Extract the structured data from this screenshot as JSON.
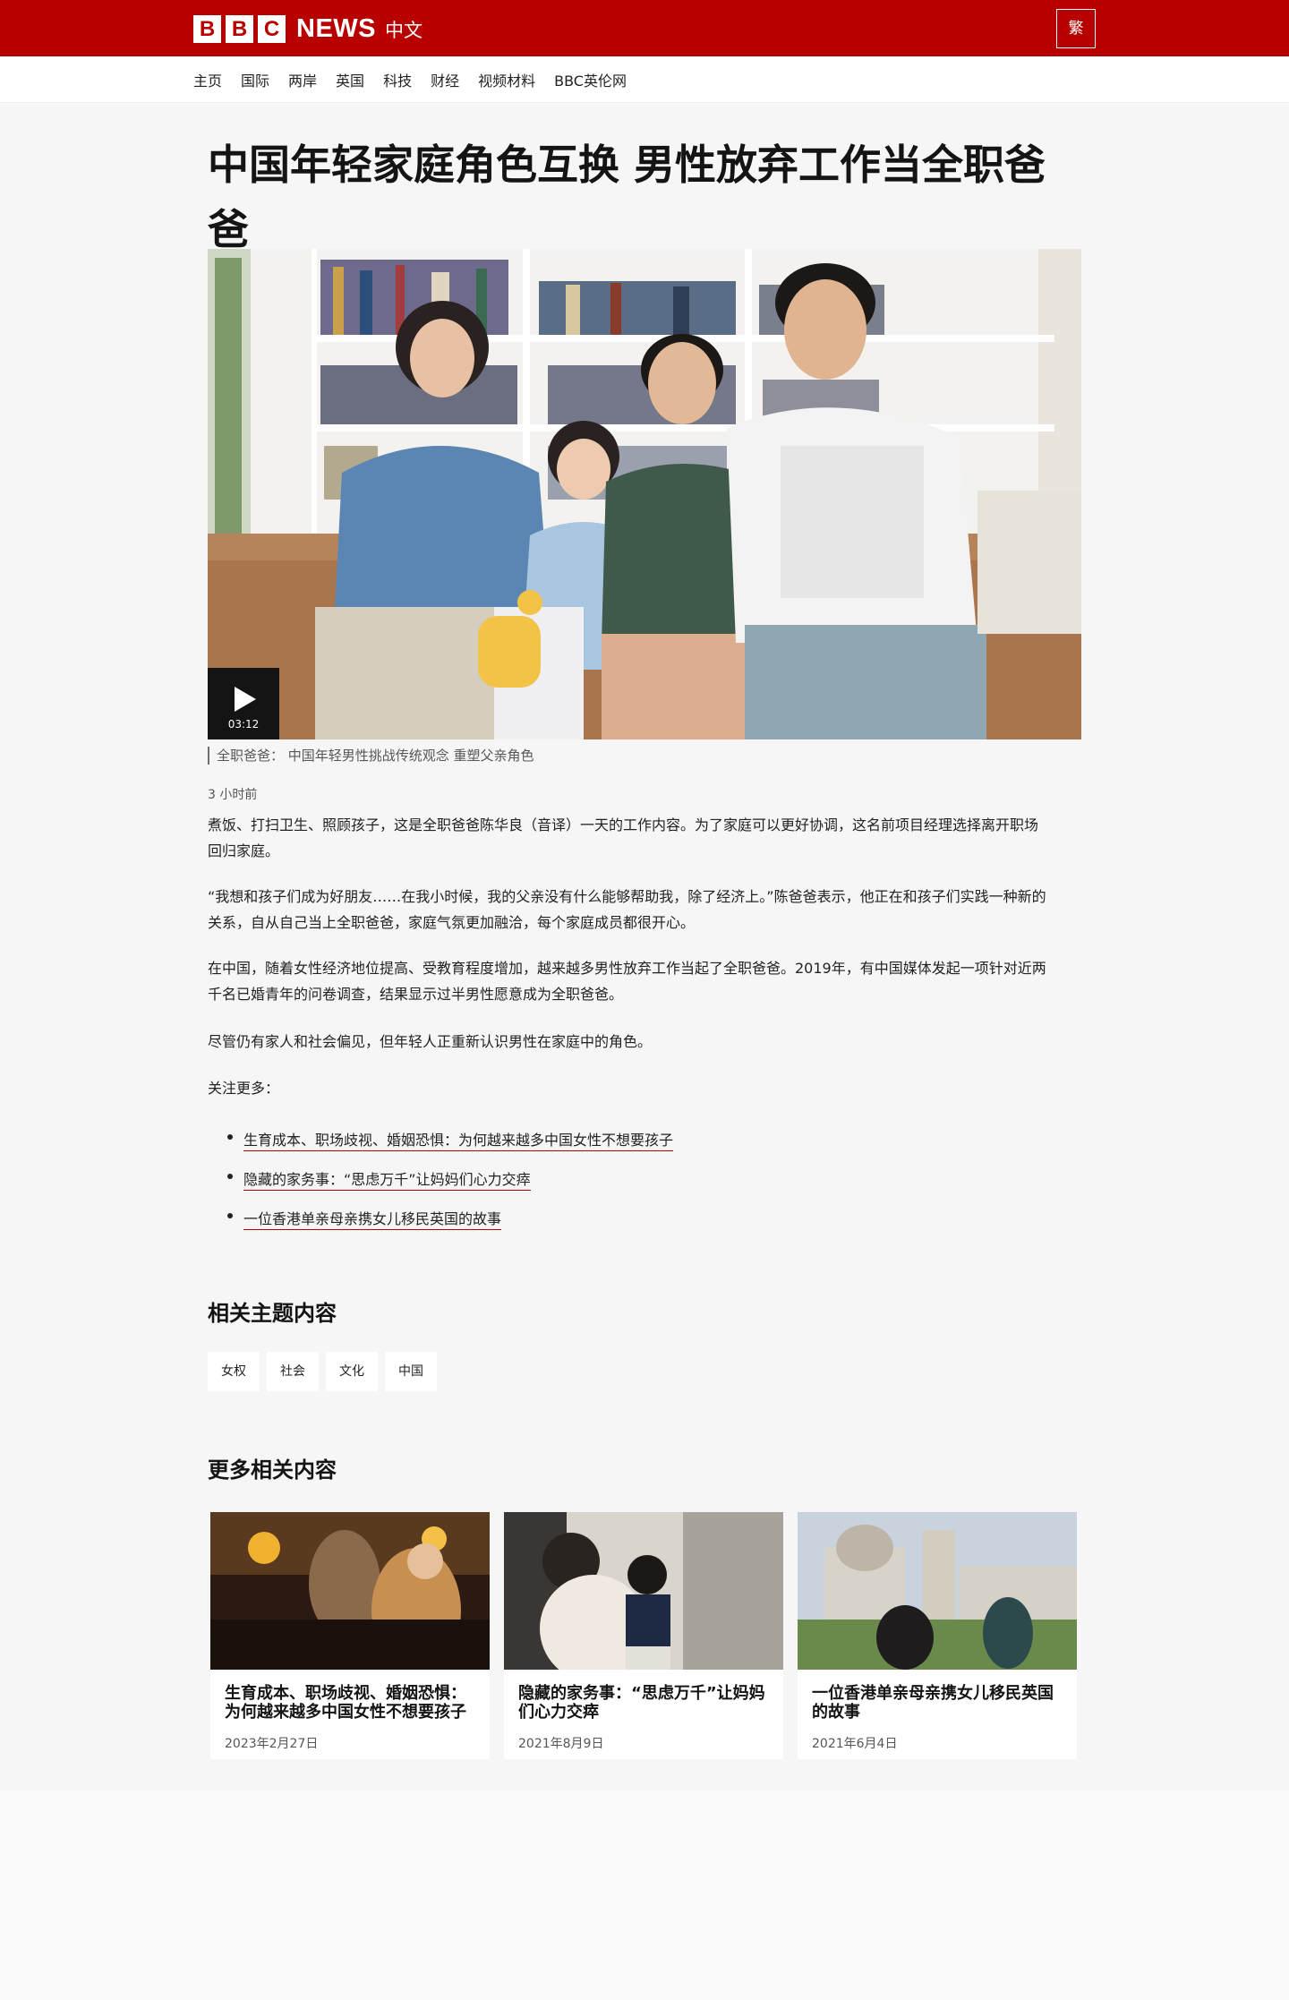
{
  "header": {
    "logo_letters": [
      "B",
      "B",
      "C"
    ],
    "logo_news": "NEWS",
    "logo_lang": "中文",
    "trad_button": "繁",
    "brand_color": "#b80000"
  },
  "nav": {
    "items": [
      "主页",
      "国际",
      "两岸",
      "英国",
      "科技",
      "财经",
      "视频材料",
      "BBC英伦网"
    ]
  },
  "article": {
    "headline": "中国年轻家庭角色互换 男性放弃工作当全职爸爸",
    "video": {
      "duration": "03:12",
      "icon": "play-icon"
    },
    "caption": "全职爸爸：  中国年轻男性挑战传统观念 重塑父亲角色",
    "time_ago": "3 小时前",
    "paragraphs": [
      "煮饭、打扫卫生、照顾孩子，这是全职爸爸陈华良（音译）一天的工作内容。为了家庭可以更好协调，这名前项目经理选择离开职场回归家庭。",
      "“我想和孩子们成为好朋友……在我小时候，我的父亲没有什么能够帮助我，除了经济上。”陈爸爸表示，他正在和孩子们实践一种新的关系，自从自己当上全职爸爸，家庭气氛更加融洽，每个家庭成员都很开心。",
      "在中国，随着女性经济地位提高、受教育程度增加，越来越多男性放弃工作当起了全职爸爸。2019年，有中国媒体发起一项针对近两千名已婚青年的问卷调查，结果显示过半男性愿意成为全职爸爸。",
      "尽管仍有家人和社会偏见，但年轻人正重新认识男性在家庭中的角色。",
      "关注更多："
    ],
    "related_links": [
      "生育成本、职场歧视、婚姻恐惧：为何越来越多中国女性不想要孩子",
      "隐藏的家务事：“思虑万千”让妈妈们心力交瘁",
      "一位香港单亲母亲携女儿移民英国的故事"
    ]
  },
  "topics": {
    "title": "相关主题内容",
    "tags": [
      "女权",
      "社会",
      "文化",
      "中国"
    ]
  },
  "more": {
    "title": "更多相关内容",
    "cards": [
      {
        "title": "生育成本、职场歧视、婚姻恐惧：为何越来越多中国女性不想要孩子",
        "date": "2023年2月27日"
      },
      {
        "title": "隐藏的家务事：“思虑万千”让妈妈们心力交瘁",
        "date": "2021年8月9日"
      },
      {
        "title": "一位香港单亲母亲携女儿移民英国的故事",
        "date": "2021年6月4日"
      }
    ]
  }
}
